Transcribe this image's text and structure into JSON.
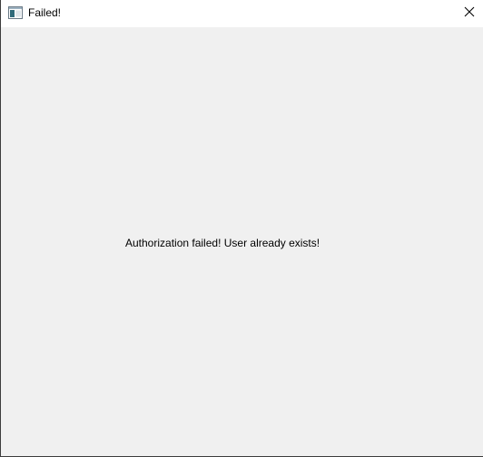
{
  "window": {
    "title": "Failed!",
    "icon": "app-window-icon",
    "close_icon": "close-icon"
  },
  "content": {
    "message": "Authorization failed! User already exists!"
  },
  "colors": {
    "titlebar_bg": "#ffffff",
    "client_bg": "#f0f0f0",
    "border": "#3c3c3c",
    "text": "#000000"
  }
}
